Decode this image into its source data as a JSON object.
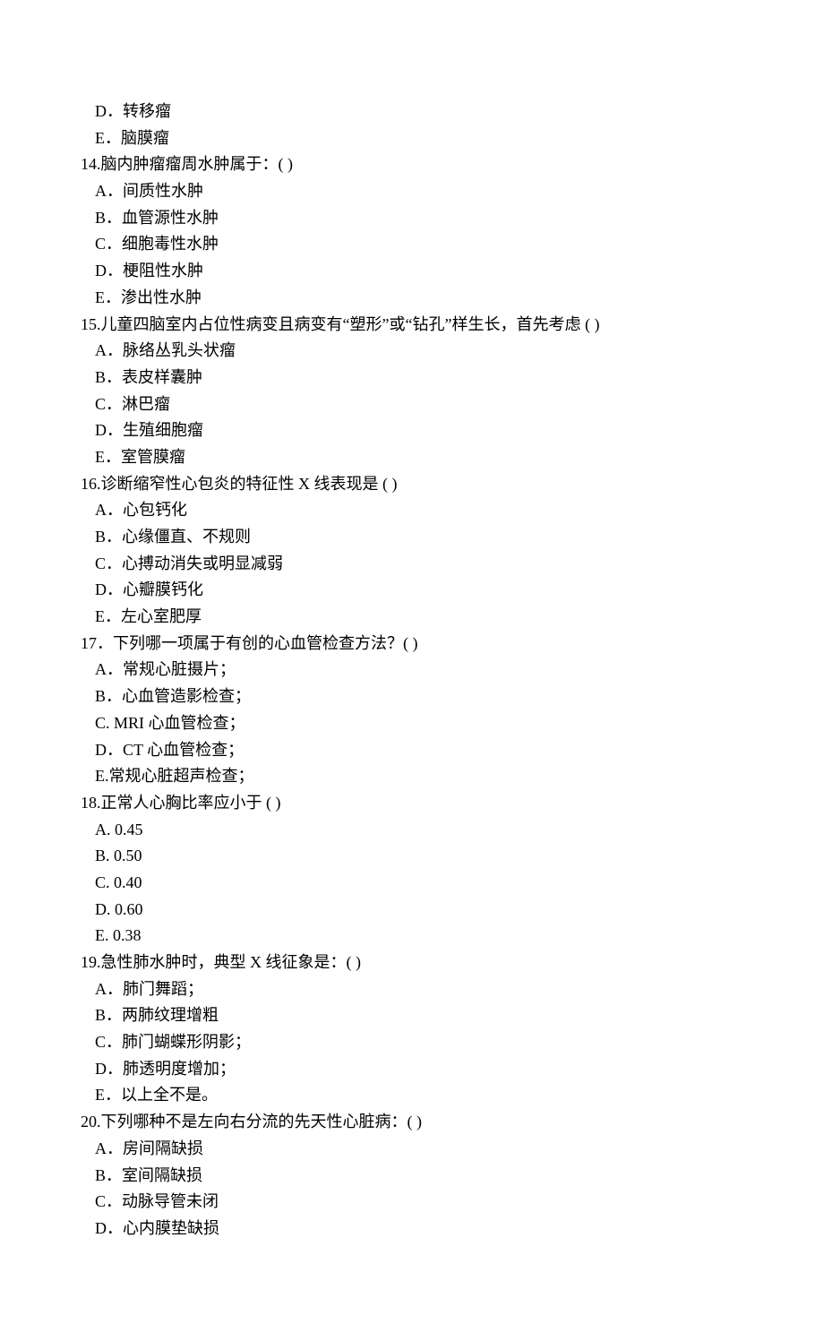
{
  "items": [
    {
      "cls": "option",
      "text": "D．转移瘤"
    },
    {
      "cls": "option",
      "text": "E．脑膜瘤"
    },
    {
      "cls": "question",
      "text": "14.脑内肿瘤瘤周水肿属于：(       )"
    },
    {
      "cls": "option",
      "text": "A．间质性水肿"
    },
    {
      "cls": "option",
      "text": "B．血管源性水肿"
    },
    {
      "cls": "option",
      "text": "C．细胞毒性水肿"
    },
    {
      "cls": "option",
      "text": "D．梗阻性水肿"
    },
    {
      "cls": "option",
      "text": "E．渗出性水肿"
    },
    {
      "cls": "question",
      "text": "15.儿童四脑室内占位性病变且病变有“塑形”或“钻孔”样生长，首先考虑 (     )"
    },
    {
      "cls": "option",
      "text": "A．脉络丛乳头状瘤"
    },
    {
      "cls": "option",
      "text": "B．表皮样囊肿"
    },
    {
      "cls": "option",
      "text": "C．淋巴瘤"
    },
    {
      "cls": "option",
      "text": "D．生殖细胞瘤"
    },
    {
      "cls": "option",
      "text": "E．室管膜瘤"
    },
    {
      "cls": "question",
      "text": "16.诊断缩窄性心包炎的特征性 X 线表现是   (       )"
    },
    {
      "cls": "option",
      "text": "A．心包钙化"
    },
    {
      "cls": "option",
      "text": "B．心缘僵直、不规则"
    },
    {
      "cls": "option",
      "text": "C．心搏动消失或明显减弱"
    },
    {
      "cls": "option",
      "text": "D．心瓣膜钙化"
    },
    {
      "cls": "option",
      "text": "E．左心室肥厚"
    },
    {
      "cls": "question",
      "text": "17．下列哪一项属于有创的心血管检查方法？(       )"
    },
    {
      "cls": "option",
      "text": "A．常规心脏摄片；"
    },
    {
      "cls": "option",
      "text": "B．心血管造影检查；"
    },
    {
      "cls": "option",
      "text": "C. MRI 心血管检查；"
    },
    {
      "cls": "option",
      "text": "D．CT 心血管检查；"
    },
    {
      "cls": "option",
      "text": "E.常规心脏超声检查；"
    },
    {
      "cls": "question",
      "text": "18.正常人心胸比率应小于 (         )"
    },
    {
      "cls": "option",
      "text": "A. 0.45"
    },
    {
      "cls": "option",
      "text": "B. 0.50"
    },
    {
      "cls": "option",
      "text": "C. 0.40"
    },
    {
      "cls": "option",
      "text": "D. 0.60"
    },
    {
      "cls": "option",
      "text": "E. 0.38"
    },
    {
      "cls": "question",
      "text": "19.急性肺水肿时，典型 X 线征象是：(       )"
    },
    {
      "cls": "option",
      "text": "A．肺门舞蹈；"
    },
    {
      "cls": "option",
      "text": "B．两肺纹理增粗"
    },
    {
      "cls": "option",
      "text": "C．肺门蝴蝶形阴影；"
    },
    {
      "cls": "option",
      "text": "D．肺透明度增加；"
    },
    {
      "cls": "option",
      "text": "E．以上全不是。"
    },
    {
      "cls": "question",
      "text": "20.下列哪种不是左向右分流的先天性心脏病：(        )"
    },
    {
      "cls": "option",
      "text": "A．房间隔缺损"
    },
    {
      "cls": "option",
      "text": "B．室间隔缺损"
    },
    {
      "cls": "option",
      "text": "C．动脉导管未闭"
    },
    {
      "cls": "option",
      "text": "D．心内膜垫缺损"
    }
  ]
}
